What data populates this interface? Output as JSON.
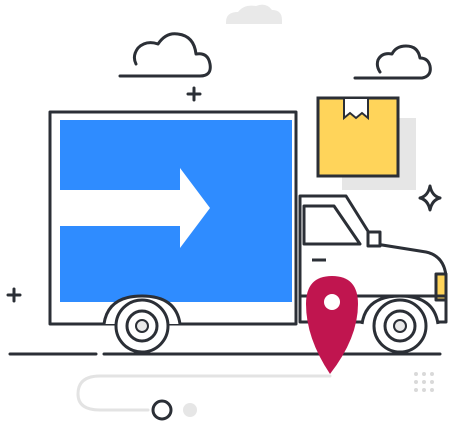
{
  "illustration": {
    "subject": "delivery-truck",
    "icons": [
      "cloud-icon",
      "package-box-icon",
      "truck-icon",
      "arrow-right-icon",
      "map-pin-icon",
      "wheel-icon",
      "sparkle-icon",
      "plus-icon",
      "dot-grid-icon"
    ]
  },
  "colors": {
    "outline": "#2b2f36",
    "truck_panel": "#2f8cff",
    "arrow": "#ffffff",
    "box_fill": "#ffd45a",
    "box_shadow": "#e6e6e6",
    "pin": "#c0154f",
    "light_gray": "#e9e9e9",
    "accent_yellow": "#ffd45a"
  }
}
